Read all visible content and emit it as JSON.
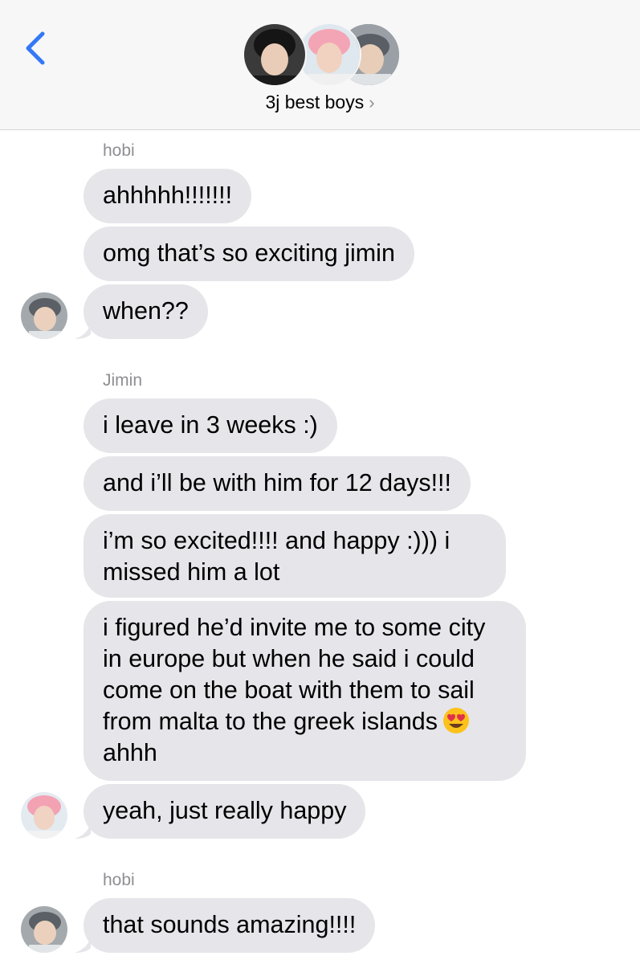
{
  "header": {
    "title": "3j best boys",
    "chevron": "›"
  },
  "messages": {
    "sender1": "hobi",
    "m1": "ahhhhh!!!!!!!",
    "m2": "omg that’s so exciting jimin",
    "m3": "when??",
    "sender2": "Jimin",
    "m4": "i leave in 3 weeks :)",
    "m5": "and i’ll be with him for 12 days!!!",
    "m6": "i’m so excited!!!! and happy :))) i missed him a lot",
    "m7a": "i figured he’d invite me to some city in europe but when he said i could come on the boat with them to sail from malta to the greek islands",
    "m7b": "ahhh",
    "m8": "yeah, just really happy",
    "sender3": "hobi",
    "m9": "that sounds amazing!!!!"
  },
  "colors": {
    "accent": "#3478f6",
    "bubble": "#e5e5ea",
    "secondary_text": "#8e8e93"
  },
  "icons": {
    "back": "chevron-left-icon",
    "emoji": "heart-eyes-emoji-icon"
  }
}
